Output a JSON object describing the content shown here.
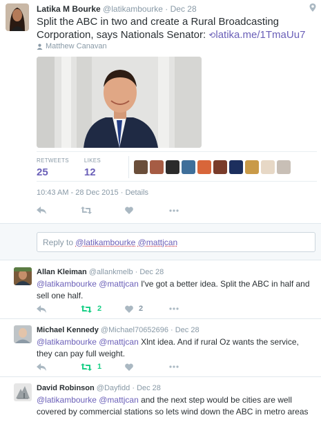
{
  "main_tweet": {
    "author_name": "Latika M Bourke",
    "author_handle": "@latikambourke",
    "separator": "·",
    "date": "Dec 28",
    "text_before": "Split the ABC in two and create a Rural Broadcasting Corporation, says Nationals Senator: ",
    "link_text": "latika.me/1TmaUu7",
    "by_line": "Matthew Canavan",
    "stats": {
      "retweets_label": "RETWEETS",
      "retweets_value": "25",
      "likes_label": "LIKES",
      "likes_value": "12"
    },
    "timestamp": "10:43 AM - 28 Dec 2015",
    "details_label": "Details"
  },
  "reply_box": {
    "prefix": "Reply to ",
    "mention1": "@latikambourke",
    "mention2": "@mattjcan"
  },
  "replies": [
    {
      "author_name": "Allan Kleiman",
      "author_handle": "@allankmelb",
      "date": "Dec 28",
      "mentions": "@latikambourke @mattjcan",
      "text": " I've got a better idea. Split the ABC in half and sell one half.",
      "retweets": "2",
      "likes": "2"
    },
    {
      "author_name": "Michael Kennedy",
      "author_handle": "@Michael70652696",
      "date": "Dec 28",
      "mentions": "@latikambourke @mattjcan",
      "text": " Xlnt idea. And if rural Oz wants the service, they can pay full weight.",
      "retweets": "1",
      "likes": ""
    },
    {
      "author_name": "David Robinson",
      "author_handle": "@Dayfidd",
      "date": "Dec 28",
      "mentions": "@latikambourke @mattjcan",
      "text": " and the next step would be cities are well covered by commercial stations so lets wind down the ABC in metro areas",
      "retweets": "",
      "likes": ""
    }
  ],
  "colors": {
    "accent": "#6a5fb8",
    "muted": "#8899a6",
    "retweet_active": "#19cf86",
    "liker_avatars": [
      "#6b4e3a",
      "#a65c44",
      "#2b2b2b",
      "#3f6f9a",
      "#d8663a",
      "#7a3c2a",
      "#1c2f5e",
      "#c99a48",
      "#e7d8c6",
      "#c8bfb6"
    ]
  },
  "icons": [
    "pin-icon",
    "user-icon",
    "reply-icon",
    "retweet-icon",
    "like-icon",
    "more-icon"
  ]
}
